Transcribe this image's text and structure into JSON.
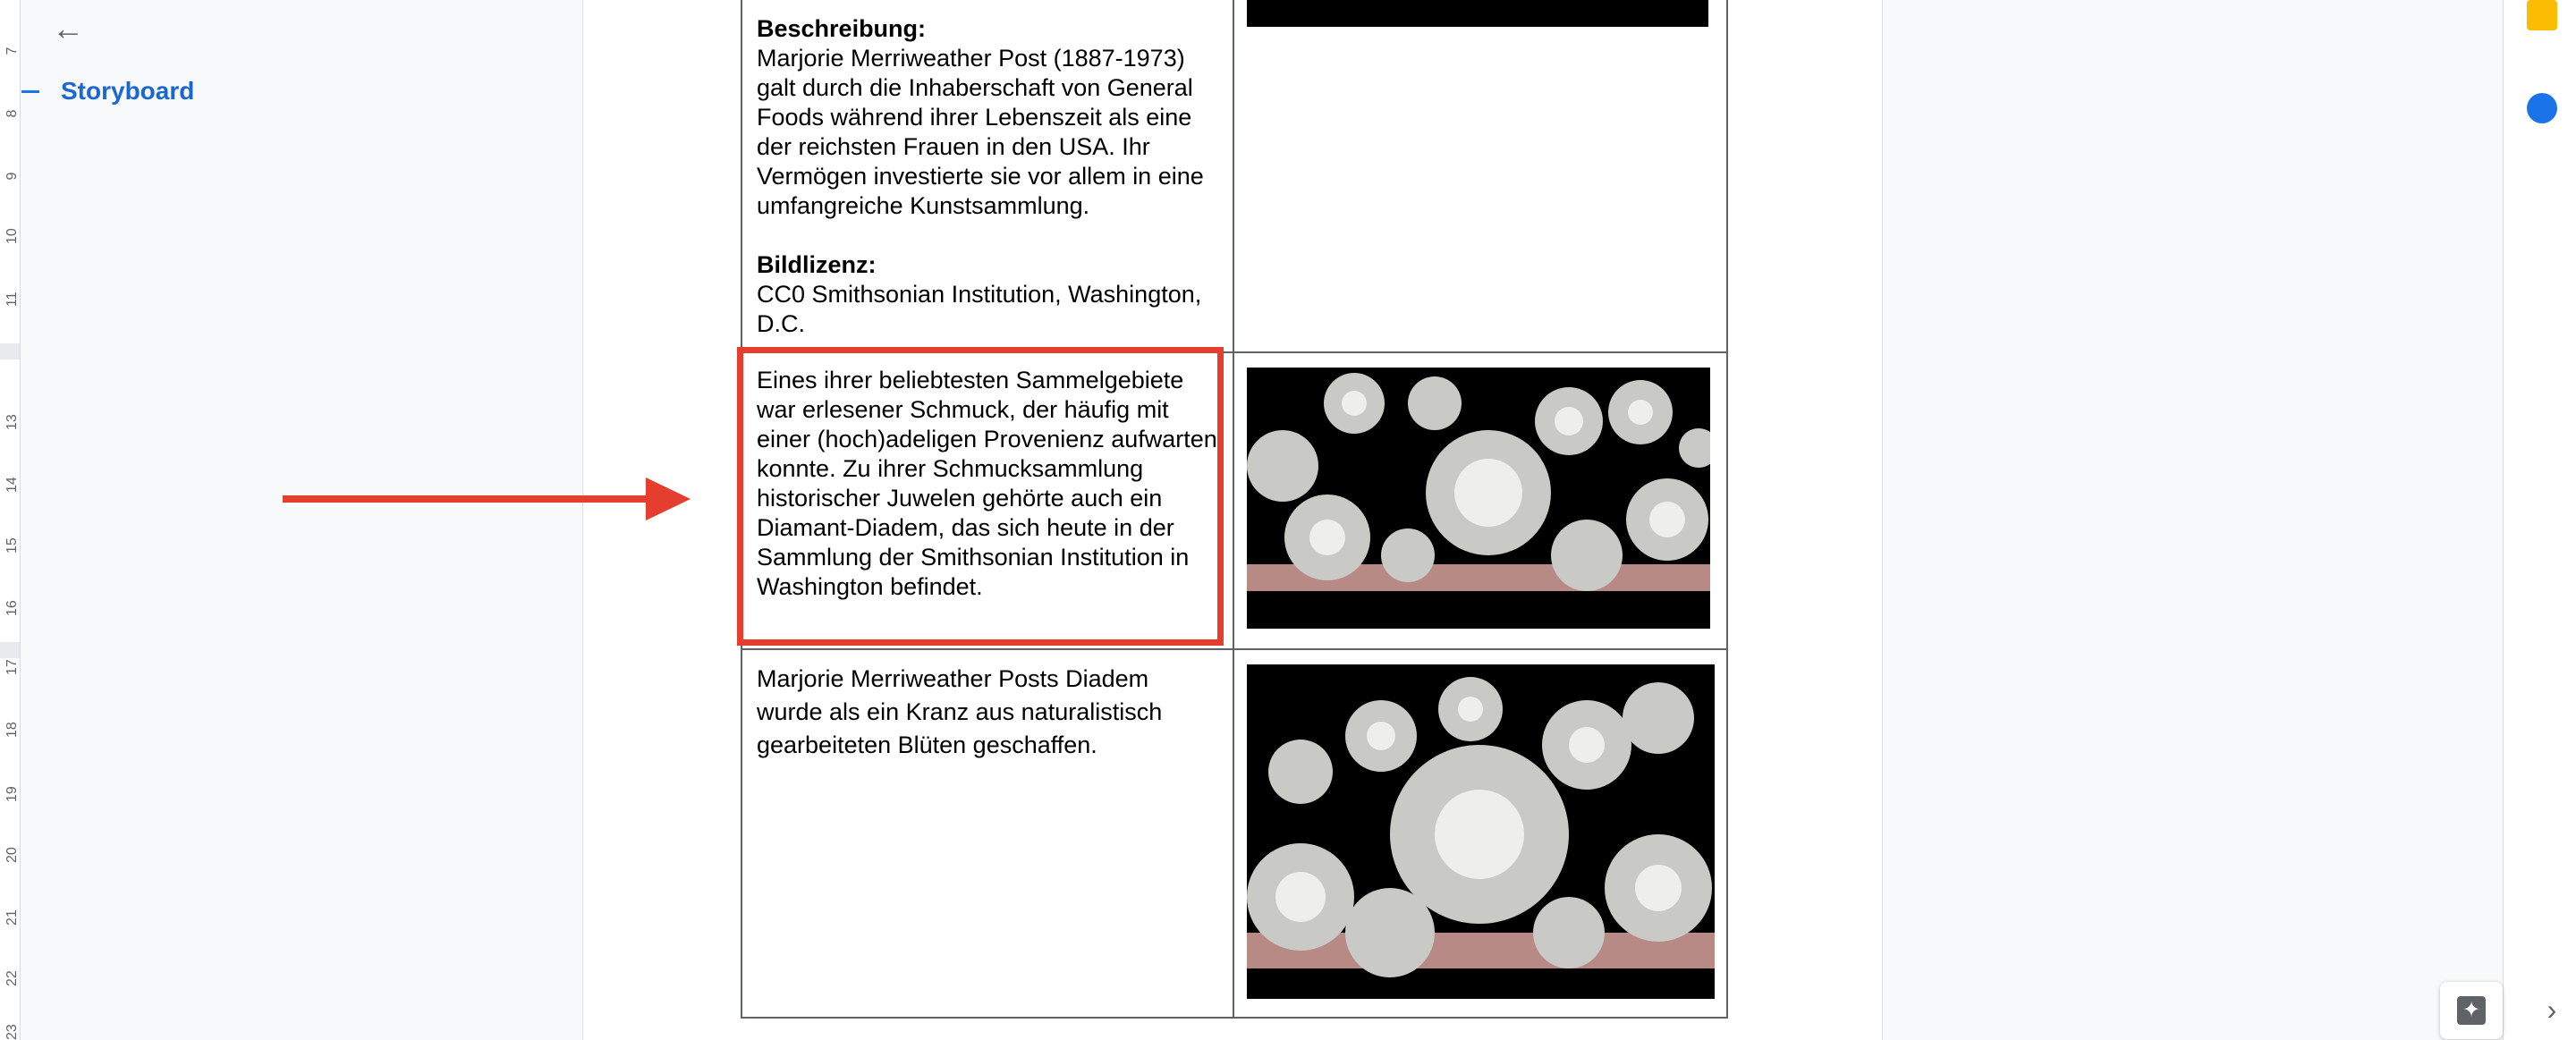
{
  "outline": {
    "item_label": "Storyboard"
  },
  "ruler": {
    "ticks": [
      "7",
      "8",
      "9",
      "10",
      "11",
      "13",
      "14",
      "15",
      "16",
      "17",
      "18",
      "19",
      "20",
      "21",
      "22",
      "23"
    ]
  },
  "document": {
    "row1": {
      "desc_heading": "Beschreibung:",
      "desc_text": "Marjorie Merriweather Post (1887-1973) galt durch die Inhaberschaft von General Foods während ihrer Lebenszeit als eine der reichsten Frauen in den USA. Ihr Vermögen investierte sie vor allem in eine umfangreiche Kunstsammlung.",
      "license_heading": "Bildlizenz:",
      "license_text": "CC0 Smithsonian Institution, Washington, D.C."
    },
    "row2": {
      "text": "Eines ihrer beliebtesten Sammelgebiete war erlesener Schmuck, der häufig mit einer (hoch)adeligen Provenienz aufwarten konnte. Zu ihrer Schmucksammlung historischer Juwelen gehörte auch ein Diamant-Diadem, das sich heute in der Sammlung der Smithsonian Institution in Washington befindet."
    },
    "row3": {
      "text": "Marjorie Merriweather Posts Diadem wurde als ein Kranz aus naturalistisch gearbeiteten Blüten geschaffen."
    }
  },
  "colors": {
    "accent": "#1a73e8",
    "highlight": "#e53d2e"
  },
  "icons": [
    "back-arrow-icon",
    "keep-icon",
    "tasks-icon",
    "expand-icon",
    "explore-icon"
  ]
}
